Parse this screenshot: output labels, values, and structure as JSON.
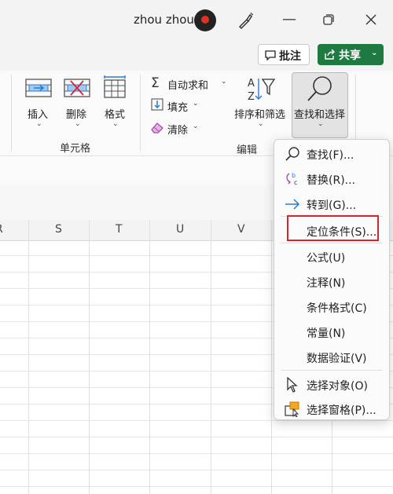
{
  "titlebar": {
    "user_name": "zhou zhou",
    "icons": [
      "avatar",
      "designer-pen-icon",
      "minimize-icon",
      "restore-icon",
      "close-icon"
    ]
  },
  "commandbar": {
    "comment_label": "批注",
    "share_label": "共享"
  },
  "ribbon": {
    "cells_group": {
      "label": "单元格",
      "insert": "插入",
      "delete": "删除",
      "format": "格式"
    },
    "edit_group": {
      "label": "编辑",
      "autosum": "自动求和",
      "fill": "填充",
      "clear": "清除",
      "sort_filter": "排序和筛选",
      "find_select": "查找和选择"
    }
  },
  "sheet": {
    "columns": [
      "R",
      "S",
      "T",
      "U",
      "V"
    ]
  },
  "menu": {
    "items": [
      {
        "label": "查找(F)...",
        "icon": "search-icon"
      },
      {
        "label": "替换(R)...",
        "icon": "replace-icon"
      },
      {
        "label": "转到(G)...",
        "icon": "arrow-right-icon"
      },
      {
        "label": "定位条件(S)...",
        "icon": ""
      },
      {
        "label": "公式(U)",
        "icon": ""
      },
      {
        "label": "注释(N)",
        "icon": ""
      },
      {
        "label": "条件格式(C)",
        "icon": ""
      },
      {
        "label": "常量(N)",
        "icon": ""
      },
      {
        "label": "数据验证(V)",
        "icon": ""
      },
      {
        "label": "选择对象(O)",
        "icon": "pointer-icon"
      },
      {
        "label": "选择窗格(P)...",
        "icon": "selection-pane-icon"
      }
    ]
  },
  "colors": {
    "share_green": "#1e7a40",
    "highlight_red": "#d9232d"
  }
}
